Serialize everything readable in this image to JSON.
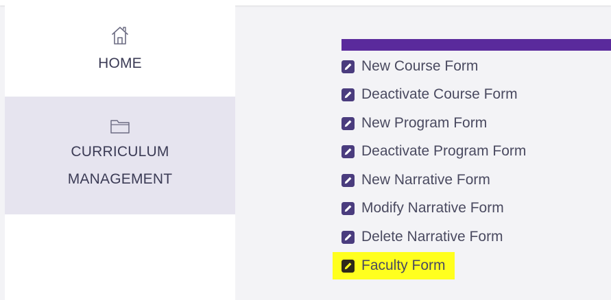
{
  "sidebar": {
    "items": [
      {
        "label": "HOME",
        "icon": "home-icon"
      },
      {
        "label_lines": [
          "CURRICULUM",
          "MANAGEMENT"
        ],
        "icon": "folder-icon",
        "selected": true
      }
    ]
  },
  "main": {
    "forms": [
      {
        "label": "New Course Form"
      },
      {
        "label": "Deactivate Course Form"
      },
      {
        "label": "New Program Form"
      },
      {
        "label": "Deactivate Program Form"
      },
      {
        "label": "New Narrative Form"
      },
      {
        "label": "Modify Narrative Form"
      },
      {
        "label": "Delete Narrative Form"
      },
      {
        "label": "Faculty Form",
        "highlighted": true
      }
    ],
    "icon": "edit-icon"
  },
  "colors": {
    "accent": "#5a2a9c",
    "highlight": "#ffff1e",
    "selected_nav_bg": "#e6e4ef",
    "icon_fill": "#4a3c7e"
  }
}
